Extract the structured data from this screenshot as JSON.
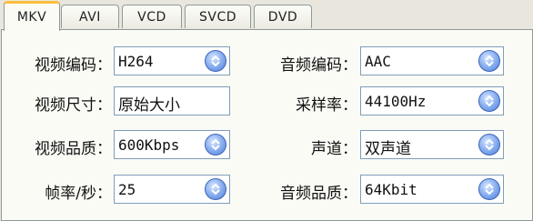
{
  "tabs": [
    {
      "label": "MKV",
      "active": true
    },
    {
      "label": "AVI",
      "active": false
    },
    {
      "label": "VCD",
      "active": false
    },
    {
      "label": "SVCD",
      "active": false
    },
    {
      "label": "DVD",
      "active": false
    }
  ],
  "video": {
    "codec": {
      "label": "视频编码：",
      "value": "H264"
    },
    "size": {
      "label": "视频尺寸：",
      "value": "原始大小"
    },
    "quality": {
      "label": "视频品质：",
      "value": "600Kbps"
    },
    "framerate": {
      "label": "帧率/秒：",
      "value": "25"
    }
  },
  "audio": {
    "codec": {
      "label": "音频编码：",
      "value": "AAC"
    },
    "samplerate": {
      "label": "采样率：",
      "value": "44100Hz"
    },
    "channel": {
      "label": "声道：",
      "value": "双声道"
    },
    "quality": {
      "label": "音频品质：",
      "value": "64Kbit"
    }
  },
  "icons": {
    "dropdown": "updown-arrows-icon"
  },
  "colors": {
    "active_tab_accent": "#ffbe3d",
    "button_blue": "#4d7fd9"
  }
}
